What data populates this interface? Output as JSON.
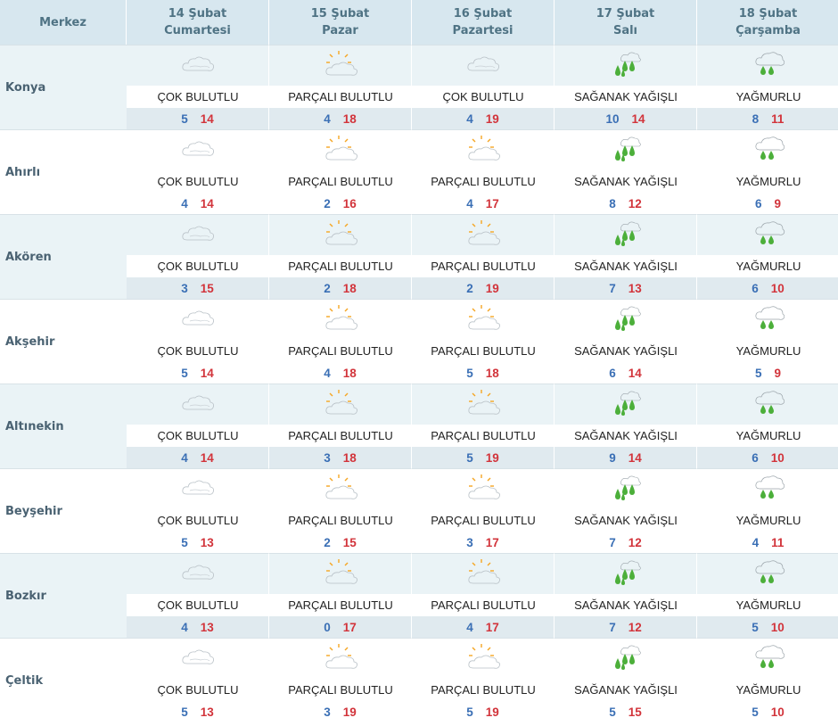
{
  "header": {
    "location_label": "Merkez",
    "days": [
      {
        "date": "14 Şubat",
        "weekday": "Cumartesi"
      },
      {
        "date": "15 Şubat",
        "weekday": "Pazar"
      },
      {
        "date": "16 Şubat",
        "weekday": "Pazartesi"
      },
      {
        "date": "17 Şubat",
        "weekday": "Salı"
      },
      {
        "date": "18 Şubat",
        "weekday": "Çarşamba"
      }
    ]
  },
  "colors": {
    "min_temp": "#3a6fb5",
    "max_temp": "#d2343b",
    "header_bg": "#d7e7ef",
    "stripe_bg": "#eaf3f6"
  },
  "rows": [
    {
      "city": "Konya",
      "days": [
        {
          "icon": "cloudy-icon",
          "condition": "ÇOK BULUTLU",
          "min": "5",
          "max": "14"
        },
        {
          "icon": "partly-cloudy-icon",
          "condition": "PARÇALI BULUTLU",
          "min": "4",
          "max": "18"
        },
        {
          "icon": "cloudy-icon",
          "condition": "ÇOK BULUTLU",
          "min": "4",
          "max": "19"
        },
        {
          "icon": "shower-icon",
          "condition": "SAĞANAK YAĞIŞLI",
          "min": "10",
          "max": "14"
        },
        {
          "icon": "rain-icon",
          "condition": "YAĞMURLU",
          "min": "8",
          "max": "11"
        }
      ]
    },
    {
      "city": "Ahırlı",
      "days": [
        {
          "icon": "cloudy-icon",
          "condition": "ÇOK BULUTLU",
          "min": "4",
          "max": "14"
        },
        {
          "icon": "partly-cloudy-icon",
          "condition": "PARÇALI BULUTLU",
          "min": "2",
          "max": "16"
        },
        {
          "icon": "partly-cloudy-icon",
          "condition": "PARÇALI BULUTLU",
          "min": "4",
          "max": "17"
        },
        {
          "icon": "shower-icon",
          "condition": "SAĞANAK YAĞIŞLI",
          "min": "8",
          "max": "12"
        },
        {
          "icon": "rain-icon",
          "condition": "YAĞMURLU",
          "min": "6",
          "max": "9"
        }
      ]
    },
    {
      "city": "Akören",
      "days": [
        {
          "icon": "cloudy-icon",
          "condition": "ÇOK BULUTLU",
          "min": "3",
          "max": "15"
        },
        {
          "icon": "partly-cloudy-icon",
          "condition": "PARÇALI BULUTLU",
          "min": "2",
          "max": "18"
        },
        {
          "icon": "partly-cloudy-icon",
          "condition": "PARÇALI BULUTLU",
          "min": "2",
          "max": "19"
        },
        {
          "icon": "shower-icon",
          "condition": "SAĞANAK YAĞIŞLI",
          "min": "7",
          "max": "13"
        },
        {
          "icon": "rain-icon",
          "condition": "YAĞMURLU",
          "min": "6",
          "max": "10"
        }
      ]
    },
    {
      "city": "Akşehir",
      "days": [
        {
          "icon": "cloudy-icon",
          "condition": "ÇOK BULUTLU",
          "min": "5",
          "max": "14"
        },
        {
          "icon": "partly-cloudy-icon",
          "condition": "PARÇALI BULUTLU",
          "min": "4",
          "max": "18"
        },
        {
          "icon": "partly-cloudy-icon",
          "condition": "PARÇALI BULUTLU",
          "min": "5",
          "max": "18"
        },
        {
          "icon": "shower-icon",
          "condition": "SAĞANAK YAĞIŞLI",
          "min": "6",
          "max": "14"
        },
        {
          "icon": "rain-icon",
          "condition": "YAĞMURLU",
          "min": "5",
          "max": "9"
        }
      ]
    },
    {
      "city": "Altınekin",
      "days": [
        {
          "icon": "cloudy-icon",
          "condition": "ÇOK BULUTLU",
          "min": "4",
          "max": "14"
        },
        {
          "icon": "partly-cloudy-icon",
          "condition": "PARÇALI BULUTLU",
          "min": "3",
          "max": "18"
        },
        {
          "icon": "partly-cloudy-icon",
          "condition": "PARÇALI BULUTLU",
          "min": "5",
          "max": "19"
        },
        {
          "icon": "shower-icon",
          "condition": "SAĞANAK YAĞIŞLI",
          "min": "9",
          "max": "14"
        },
        {
          "icon": "rain-icon",
          "condition": "YAĞMURLU",
          "min": "6",
          "max": "10"
        }
      ]
    },
    {
      "city": "Beyşehir",
      "days": [
        {
          "icon": "cloudy-icon",
          "condition": "ÇOK BULUTLU",
          "min": "5",
          "max": "13"
        },
        {
          "icon": "partly-cloudy-icon",
          "condition": "PARÇALI BULUTLU",
          "min": "2",
          "max": "15"
        },
        {
          "icon": "partly-cloudy-icon",
          "condition": "PARÇALI BULUTLU",
          "min": "3",
          "max": "17"
        },
        {
          "icon": "shower-icon",
          "condition": "SAĞANAK YAĞIŞLI",
          "min": "7",
          "max": "12"
        },
        {
          "icon": "rain-icon",
          "condition": "YAĞMURLU",
          "min": "4",
          "max": "11"
        }
      ]
    },
    {
      "city": "Bozkır",
      "days": [
        {
          "icon": "cloudy-icon",
          "condition": "ÇOK BULUTLU",
          "min": "4",
          "max": "13"
        },
        {
          "icon": "partly-cloudy-icon",
          "condition": "PARÇALI BULUTLU",
          "min": "0",
          "max": "17"
        },
        {
          "icon": "partly-cloudy-icon",
          "condition": "PARÇALI BULUTLU",
          "min": "4",
          "max": "17"
        },
        {
          "icon": "shower-icon",
          "condition": "SAĞANAK YAĞIŞLI",
          "min": "7",
          "max": "12"
        },
        {
          "icon": "rain-icon",
          "condition": "YAĞMURLU",
          "min": "5",
          "max": "10"
        }
      ]
    },
    {
      "city": "Çeltik",
      "days": [
        {
          "icon": "cloudy-icon",
          "condition": "ÇOK BULUTLU",
          "min": "5",
          "max": "13"
        },
        {
          "icon": "partly-cloudy-icon",
          "condition": "PARÇALI BULUTLU",
          "min": "3",
          "max": "19"
        },
        {
          "icon": "partly-cloudy-icon",
          "condition": "PARÇALI BULUTLU",
          "min": "5",
          "max": "19"
        },
        {
          "icon": "shower-icon",
          "condition": "SAĞANAK YAĞIŞLI",
          "min": "5",
          "max": "15"
        },
        {
          "icon": "rain-icon",
          "condition": "YAĞMURLU",
          "min": "5",
          "max": "10"
        }
      ]
    }
  ]
}
